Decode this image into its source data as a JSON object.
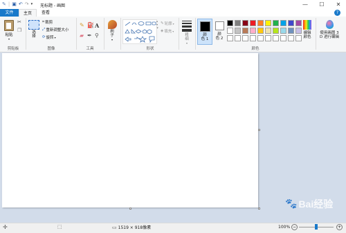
{
  "window": {
    "title": "无标题 - 画图",
    "minimize": "—",
    "maximize": "☐",
    "close": "✕"
  },
  "tabs": {
    "file": "文件",
    "home": "主页",
    "view": "查看"
  },
  "groups": {
    "clipboard": {
      "label": "剪贴板",
      "paste": "粘贴"
    },
    "image": {
      "label": "图像",
      "select": "选\n择",
      "crop": "裁剪",
      "resize": "重新调整大小",
      "rotate": "旋转"
    },
    "tools": {
      "label": "工具"
    },
    "brushes": {
      "label": "刷\n子"
    },
    "shapes": {
      "label": "形状",
      "outline": "轮廓",
      "fill": "填充"
    },
    "size": {
      "label": "粗\n细"
    },
    "colors": {
      "label": "颜色",
      "color1": "颜\n色 1",
      "color2": "颜\n色 2",
      "edit": "编辑\n颜色",
      "paint3d": "使用画图 3\nD 进行编辑",
      "row1": [
        "#000000",
        "#7f7f7f",
        "#880015",
        "#ed1c24",
        "#ff7f27",
        "#fff200",
        "#22b14c",
        "#00a2e8",
        "#3f48cc",
        "#a349a4"
      ],
      "row2": [
        "#ffffff",
        "#c3c3c3",
        "#b97a57",
        "#ffaec9",
        "#ffc90e",
        "#efe4b0",
        "#b5e61d",
        "#99d9ea",
        "#7092be",
        "#c8bfe7"
      ],
      "row3": [
        "#ffffff",
        "#ffffff",
        "#ffffff",
        "#ffffff",
        "#ffffff",
        "#ffffff",
        "#ffffff",
        "#ffffff",
        "#ffffff",
        "#ffffff"
      ]
    }
  },
  "status": {
    "dimensions": "1519 × 918像素",
    "zoom": "100%",
    "zoom_level_percent": 100
  },
  "watermark": "Bai经验"
}
